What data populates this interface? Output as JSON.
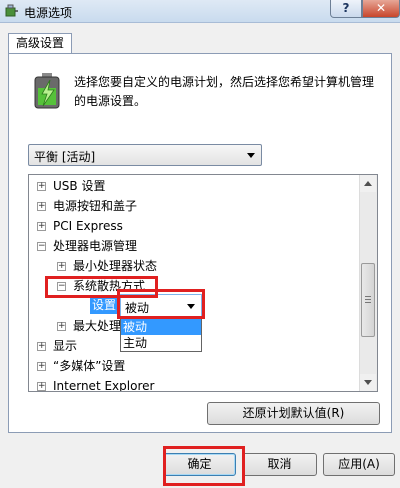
{
  "window": {
    "title": "电源选项"
  },
  "tab": {
    "label": "高级设置"
  },
  "description": "选择您要自定义的电源计划，然后选择您希望计算机管理的电源设置。",
  "plan_select": {
    "value": "平衡 [活动]"
  },
  "tree": {
    "items": [
      {
        "label": "USB 设置",
        "expander": "+"
      },
      {
        "label": "电源按钮和盖子",
        "expander": "+"
      },
      {
        "label": "PCI Express",
        "expander": "+"
      },
      {
        "label": "处理器电源管理",
        "expander": "−"
      },
      {
        "label": "最小处理器状态",
        "expander": "+"
      },
      {
        "label": "系统散热方式",
        "expander": "−"
      },
      {
        "label": "最大处理",
        "expander": "+"
      },
      {
        "label": "显示",
        "expander": "+"
      },
      {
        "label": "“多媒体”设置",
        "expander": "+"
      },
      {
        "label": "Internet Explorer",
        "expander": "+"
      }
    ],
    "setting_label": "设置",
    "setting_value": "被动",
    "dropdown_options": [
      "被动",
      "主动"
    ]
  },
  "buttons": {
    "restore_defaults": "还原计划默认值(R)",
    "ok": "确定",
    "cancel": "取消",
    "apply": "应用(A)"
  },
  "caption": {
    "help": "?",
    "close": "✕"
  },
  "colors": {
    "highlight": "#3399ff",
    "annotation": "#e02020"
  }
}
